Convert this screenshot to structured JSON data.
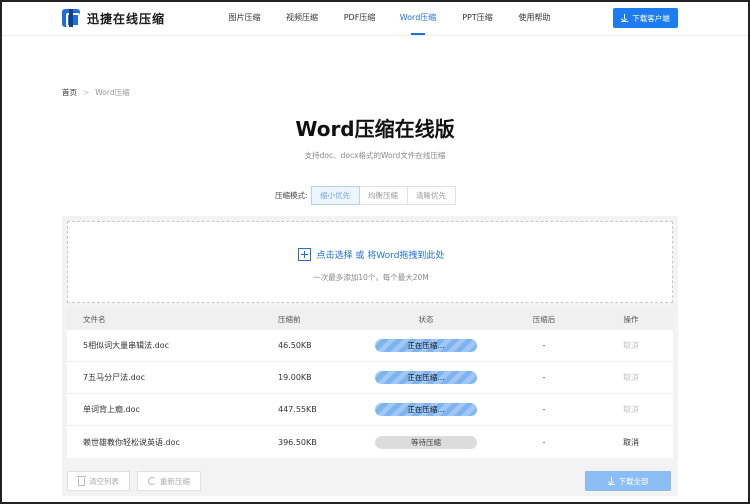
{
  "app": {
    "title": "迅捷在线压缩"
  },
  "nav": {
    "items": [
      {
        "label": "图片压缩"
      },
      {
        "label": "视频压缩"
      },
      {
        "label": "PDF压缩"
      },
      {
        "label": "Word压缩",
        "active": true
      },
      {
        "label": "PPT压缩"
      },
      {
        "label": "使用帮助"
      }
    ],
    "download_client": "下载客户端"
  },
  "breadcrumb": {
    "home": "首页",
    "separator": ">",
    "current": "Word压缩"
  },
  "page": {
    "title": "Word压缩在线版",
    "subtitle": "支持doc、docx格式的Word文件在线压缩"
  },
  "mode": {
    "label": "压缩模式:",
    "options": [
      "缩小优先",
      "均衡压缩",
      "清晰优先"
    ],
    "selected": "缩小优先"
  },
  "upload": {
    "main_text": "点击选择 或 将Word拖拽到此处",
    "hint": "一次最多添加10个，每个最大20M"
  },
  "table": {
    "headers": {
      "name": "文件名",
      "before": "压缩前",
      "status": "状态",
      "after": "压缩后",
      "action": "操作"
    },
    "rows": [
      {
        "name": "5相似词大量串辑法.doc",
        "before": "46.50KB",
        "status": "正在压缩...",
        "status_type": "active",
        "after": "-",
        "action": "取消",
        "action_enabled": false
      },
      {
        "name": "7五马分尸法.doc",
        "before": "19.00KB",
        "status": "正在压缩...",
        "status_type": "active",
        "after": "-",
        "action": "取消",
        "action_enabled": false
      },
      {
        "name": "单词背上瘾.doc",
        "before": "447.55KB",
        "status": "正在压缩...",
        "status_type": "active",
        "after": "-",
        "action": "取消",
        "action_enabled": false
      },
      {
        "name": "赖世雄教你轻松说英语.doc",
        "before": "396.50KB",
        "status": "等待压缩",
        "status_type": "waiting",
        "after": "-",
        "action": "取消",
        "action_enabled": true
      }
    ]
  },
  "footer": {
    "clear_list": "清空列表",
    "recompress": "重新压缩",
    "download_all": "下载全部"
  },
  "colors": {
    "brand": "#1e6fd9",
    "download_button": "#1e7cf0",
    "download_all_disabled": "#8dbdf5"
  }
}
